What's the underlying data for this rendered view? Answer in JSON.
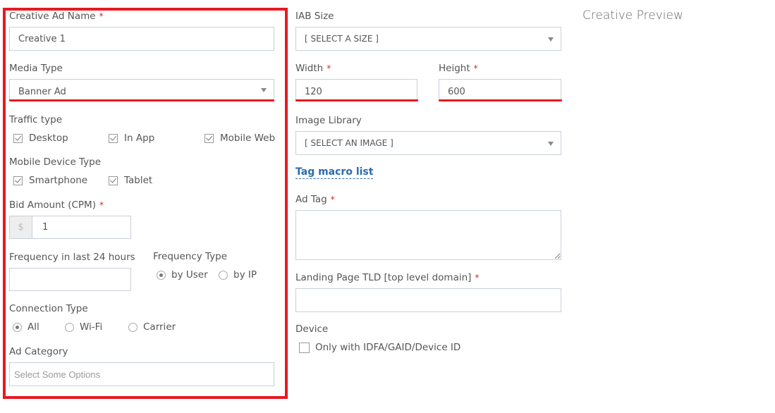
{
  "left_form": {
    "creative_name": {
      "label": "Creative Ad Name",
      "required": "*",
      "value": "Creative 1"
    },
    "media_type": {
      "label": "Media Type",
      "value": "Banner Ad"
    },
    "traffic_type": {
      "label": "Traffic type",
      "options": [
        {
          "label": "Desktop",
          "checked": true
        },
        {
          "label": "In App",
          "checked": true
        },
        {
          "label": "Mobile Web",
          "checked": true
        }
      ]
    },
    "mobile_device_type": {
      "label": "Mobile Device Type",
      "options": [
        {
          "label": "Smartphone",
          "checked": true
        },
        {
          "label": "Tablet",
          "checked": true
        }
      ]
    },
    "bid_amount": {
      "label": "Bid Amount (CPM)",
      "required": "*",
      "currency": "$",
      "value": "1"
    },
    "frequency": {
      "label": "Frequency in last 24 hours",
      "value": ""
    },
    "frequency_type": {
      "label": "Frequency Type",
      "options": [
        {
          "label": "by User",
          "selected": true
        },
        {
          "label": "by IP",
          "selected": false
        }
      ]
    },
    "connection_type": {
      "label": "Connection Type",
      "options": [
        {
          "label": "All",
          "selected": true
        },
        {
          "label": "Wi-Fi",
          "selected": false
        },
        {
          "label": "Carrier",
          "selected": false
        }
      ]
    },
    "ad_category": {
      "label": "Ad Category",
      "placeholder": "Select Some Options"
    }
  },
  "right_form": {
    "iab_size": {
      "label": "IAB Size",
      "value": "[ SELECT A SIZE ]"
    },
    "width": {
      "label": "Width",
      "required": "*",
      "value": "120"
    },
    "height": {
      "label": "Height",
      "required": "*",
      "value": "600"
    },
    "image_library": {
      "label": "Image Library",
      "value": "[ SELECT AN IMAGE ]"
    },
    "tag_macro_link": "Tag macro list",
    "ad_tag": {
      "label": "Ad Tag",
      "required": "*",
      "value": ""
    },
    "landing_page": {
      "label": "Landing Page TLD [top level domain]",
      "required": "*",
      "value": ""
    },
    "device": {
      "label": "Device",
      "option": {
        "label": "Only with IDFA/GAID/Device ID",
        "checked": false
      }
    }
  },
  "preview": {
    "title": "Creative Preview"
  },
  "colors": {
    "highlight": "#e81920",
    "link": "#2a6bb0",
    "required": "#e02020"
  }
}
